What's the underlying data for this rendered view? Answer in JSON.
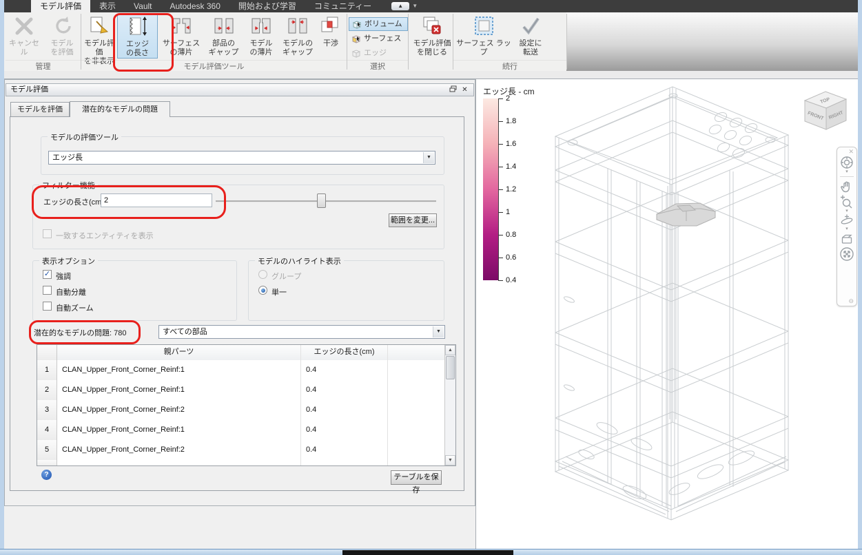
{
  "titlebar": {
    "tabs": [
      "モデル評価",
      "表示",
      "Vault",
      "Autodesk 360",
      "開始および学習",
      "コミュニティー"
    ]
  },
  "ribbon": {
    "groups": {
      "manage": "管理",
      "tools": "モデル評価ツール",
      "select": "選択",
      "continue": "続行"
    },
    "cancel": {
      "l1": "キャンセル",
      "l2": ""
    },
    "evaluate": {
      "l1": "モデル",
      "l2": "を評価"
    },
    "hide": {
      "l1": "モデル評価",
      "l2": "を非表示"
    },
    "edge_length": {
      "l1": "エッジ",
      "l2": "の長さ"
    },
    "surface_sliver": {
      "l1": "サーフェス",
      "l2": "の薄片"
    },
    "part_gap": {
      "l1": "部品の",
      "l2": "ギャップ"
    },
    "model_sliver": {
      "l1": "モデル",
      "l2": "の薄片"
    },
    "model_gap": {
      "l1": "モデルの",
      "l2": "ギャップ"
    },
    "interference": {
      "l1": "干渉",
      "l2": ""
    },
    "select_items": [
      "ボリューム",
      "サーフェス",
      "エッジ"
    ],
    "close_eval": {
      "l1": "モデル評価",
      "l2": "を閉じる"
    },
    "surface_wrap": {
      "l1": "サーフェス ラップ",
      "l2": ""
    },
    "transfer": {
      "l1": "設定に",
      "l2": "転送"
    }
  },
  "panel": {
    "title": "モデル評価",
    "tab_evaluate": "モデルを評価",
    "tab_issues": "潜在的なモデルの問題",
    "eval_tool_label": "モデルの評価ツール",
    "eval_tool_value": "エッジ長",
    "filter_label": "フィルター機能",
    "edge_len_label": "エッジの長さ(cm)",
    "edge_len_value": "2",
    "range_button": "範囲を変更...",
    "show_matching": "一致するエンティティを表示",
    "display_label": "表示オプション",
    "cb_highlight": "強調",
    "cb_auto_separate": "自動分離",
    "cb_auto_zoom": "自動ズーム",
    "highlight_label": "モデルのハイライト表示",
    "radio_group": "グループ",
    "radio_single": "単一",
    "issues_count": "潜在的なモデルの問題: 780",
    "parts_filter_value": "すべての部品",
    "table": {
      "header_part": "親パーツ",
      "header_edge": "エッジの長さ(cm)",
      "rows": [
        {
          "num": "1",
          "part": "CLAN_Upper_Front_Corner_Reinf:1",
          "len": "0.4"
        },
        {
          "num": "2",
          "part": "CLAN_Upper_Front_Corner_Reinf:1",
          "len": "0.4"
        },
        {
          "num": "3",
          "part": "CLAN_Upper_Front_Corner_Reinf:2",
          "len": "0.4"
        },
        {
          "num": "4",
          "part": "CLAN_Upper_Front_Corner_Reinf:1",
          "len": "0.4"
        },
        {
          "num": "5",
          "part": "CLAN_Upper_Front_Corner_Reinf:2",
          "len": "0.4"
        }
      ]
    },
    "save_table": "テーブルを保存"
  },
  "legend": {
    "title": "エッジ長 - cm",
    "ticks": [
      "2",
      "1.8",
      "1.6",
      "1.4",
      "1.2",
      "1",
      "0.8",
      "0.6",
      "0.4"
    ],
    "gradient_stops": [
      "#fce9e2",
      "#f5b2b8",
      "#e3679f",
      "#b31e84",
      "#7c0a67"
    ]
  },
  "viewcube": {
    "top": "TOP",
    "front": "FRONT",
    "right": "RIGHT"
  },
  "colors": {
    "annotation_red": "#e8201c",
    "selection_blue": "#cfe4f5",
    "titlebar_bg": "#3d3d3d"
  }
}
